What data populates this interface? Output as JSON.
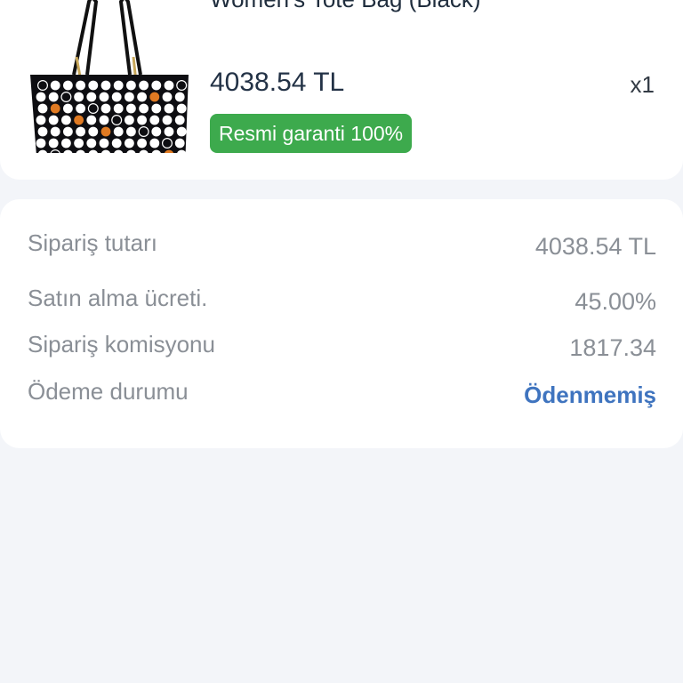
{
  "product": {
    "title": "Women's Tote Bag (Black)",
    "price": "4038.54 TL",
    "quantity": "x1",
    "badge": "Resmi garanti 100%",
    "image_icon": "tote-bag-image"
  },
  "summary": {
    "rows": [
      {
        "label": "Sipariş tutarı",
        "value": "4038.54 TL"
      },
      {
        "label": "Satın alma ücreti.",
        "value": "45.00%"
      },
      {
        "label": "Sipariş komisyonu",
        "value": "1817.34"
      },
      {
        "label": "Ödeme durumu",
        "value": "Ödenmemiş"
      }
    ]
  },
  "colors": {
    "background": "#f3f5f9",
    "card": "#ffffff",
    "badge": "#3daa4d",
    "status_link": "#3f74bf",
    "muted_text": "#8a8f96"
  }
}
